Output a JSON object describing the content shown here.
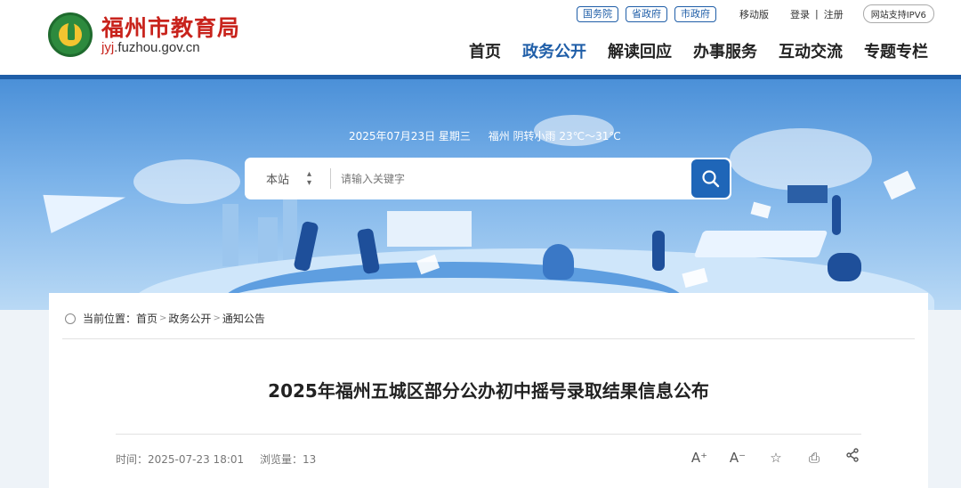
{
  "header": {
    "site_title": "福州市教育局",
    "domain_highlight": "jyj",
    "domain_rest": ".fuzhou.gov.cn",
    "pills": [
      "国务院",
      "省政府",
      "市政府"
    ],
    "mobile": "移动版",
    "login": "登录",
    "separator": "|",
    "register": "注册",
    "ipv6": "网站支持IPV6",
    "nav": [
      "首页",
      "政务公开",
      "解读回应",
      "办事服务",
      "互动交流",
      "专题专栏"
    ],
    "active_nav": "政务公开"
  },
  "banner": {
    "date": "2025年07月23日 星期三",
    "weather": "福州 阴转小雨 23℃～31℃"
  },
  "search": {
    "scope": "本站",
    "scope_arrow": "◆",
    "placeholder": "请输入关键字"
  },
  "breadcrumb": {
    "prefix": "当前位置：",
    "items": [
      "首页",
      "政务公开",
      "通知公告"
    ],
    "arrow": ">"
  },
  "article": {
    "title": "2025年福州五城区部分公办初中摇号录取结果信息公布",
    "time": "时间：2025-07-23 18:01",
    "views": "浏览量：13"
  },
  "tools": {
    "font_increase": "A⁺",
    "font_decrease": "A⁻",
    "favorite": "☆",
    "print": "⎙",
    "share": "⋖"
  },
  "colors": {
    "brand_red": "#c8231c",
    "brand_blue": "#1f5ea8"
  }
}
